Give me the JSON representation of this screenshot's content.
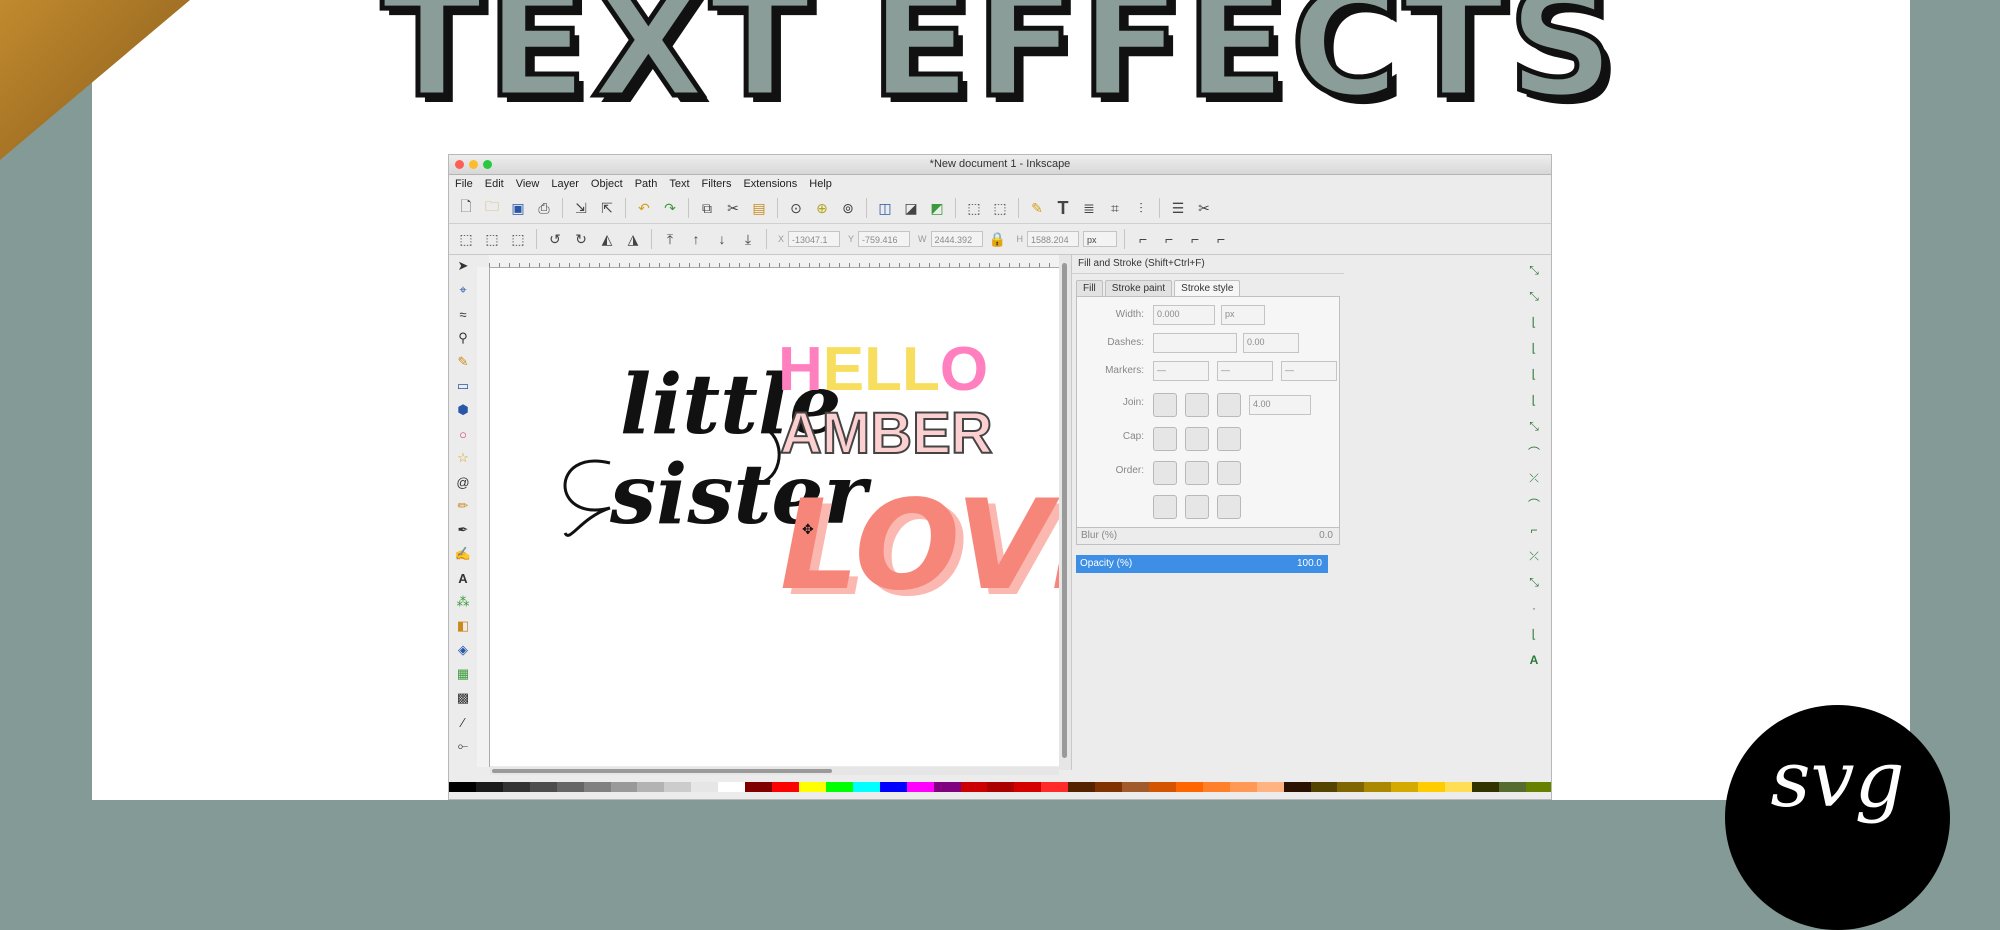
{
  "headline": "TEXT EFFECTS",
  "logo_text": "svg",
  "window": {
    "title": "*New document 1 - Inkscape",
    "menus": [
      "File",
      "Edit",
      "View",
      "Layer",
      "Object",
      "Path",
      "Text",
      "Filters",
      "Extensions",
      "Help"
    ],
    "coords": {
      "x_label": "X",
      "x_value": "-13047.1",
      "y_label": "Y",
      "y_value": "-759.416",
      "w_label": "W",
      "w_value": "2444.392",
      "h_label": "H",
      "h_value": "1588.204",
      "unit": "px"
    }
  },
  "canvas": {
    "script_line1": "little",
    "script_line2": "sister",
    "hello": [
      "H",
      "E",
      "L",
      "L",
      "O"
    ],
    "hello_colors": [
      "#ff7fbf",
      "#f7de5e",
      "#f7de5e",
      "#f7de5e",
      "#ff7fbf"
    ],
    "amber": "AMBER",
    "amber_fill": "#fcd0d0",
    "love": "LOVE",
    "love_color": "#f7867a"
  },
  "dock": {
    "title": "Fill and Stroke (Shift+Ctrl+F)",
    "tabs": [
      "Fill",
      "Stroke paint",
      "Stroke style"
    ],
    "width_label": "Width:",
    "width_value": "0.000",
    "width_unit": "px",
    "dashes_label": "Dashes:",
    "dashes_value": "0.00",
    "markers_label": "Markers:",
    "marker_value": "—",
    "join_label": "Join:",
    "join_value": "4.00",
    "cap_label": "Cap:",
    "order_label": "Order:",
    "blur_label": "Blur (%)",
    "blur_value": "0.0",
    "opacity_label": "Opacity (%)",
    "opacity_value": "100.0"
  },
  "colors": {
    "background": "#849a97",
    "accent": "#3d8ee5"
  }
}
